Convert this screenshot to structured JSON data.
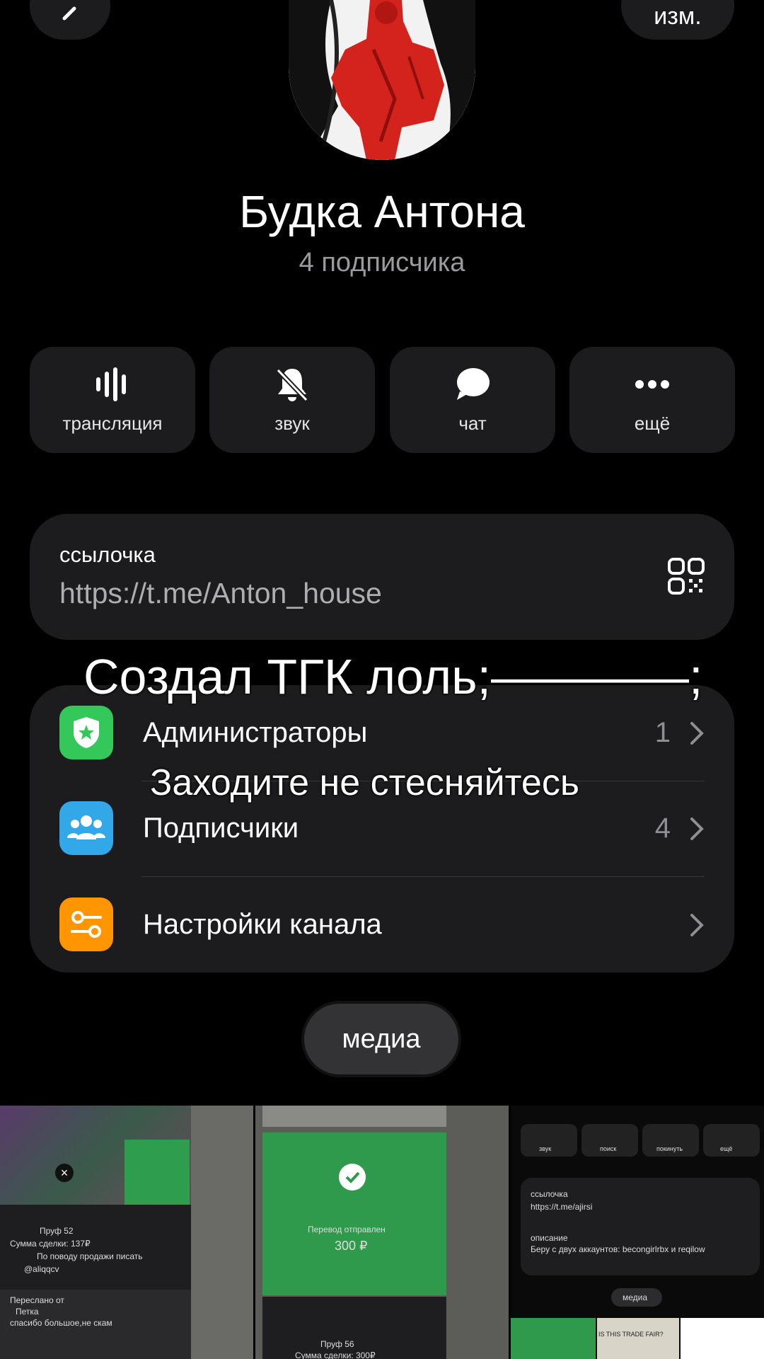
{
  "header": {
    "back_label": "",
    "edit_label": "изм."
  },
  "channel": {
    "title": "Будка Антона",
    "subtitle": "4 подписчика"
  },
  "actions": [
    {
      "label": "трансляция",
      "icon": "live-stream-icon"
    },
    {
      "label": "звук",
      "icon": "bell-mute-icon"
    },
    {
      "label": "чат",
      "icon": "chat-bubble-icon"
    },
    {
      "label": "ещё",
      "icon": "more-dots-icon"
    }
  ],
  "link": {
    "label": "ссылочка",
    "url": "https://t.me/Anton_house",
    "icon": "qr-code-icon"
  },
  "rows": [
    {
      "label": "Администраторы",
      "count": "1",
      "icon": "admin-shield-icon",
      "color": "#34c759"
    },
    {
      "label": "Подписчики",
      "count": "4",
      "icon": "people-icon",
      "color": "#32a8e8"
    },
    {
      "label": "Настройки канала",
      "count": "",
      "icon": "settings-toggle-icon",
      "color": "#ff9500"
    }
  ],
  "overlay": {
    "line1": "Создал ТГК лоль;————;",
    "line2": "Заходите не стесняйтесь"
  },
  "media": {
    "tab_label": "медиа",
    "thumb1": {
      "proof": "Пруф 52",
      "sum": "Сумма сделки: 137₽",
      "line3": "По поводу продажи писать",
      "user": "@aliqqcv",
      "fwd": "Переслано от",
      "name": "Петка",
      "thanks": "спасибо большое,не скам"
    },
    "thumb2": {
      "sent": "Перевод отправлен",
      "amount": "300 ₽",
      "proof": "Пруф 56",
      "sum": "Сумма сделки: 300₽"
    },
    "thumb3": {
      "actions": [
        "звук",
        "поиск",
        "покинуть",
        "ещё"
      ],
      "link_label": "ссылочка",
      "link_url": "https://t.me/ajirsi",
      "desc_label": "описание",
      "desc": "Беру с двух аккаунтов: becongirlrbx и reqilow",
      "media_label": "медиа",
      "fair": "IS THIS TRADE FAIR?"
    }
  }
}
